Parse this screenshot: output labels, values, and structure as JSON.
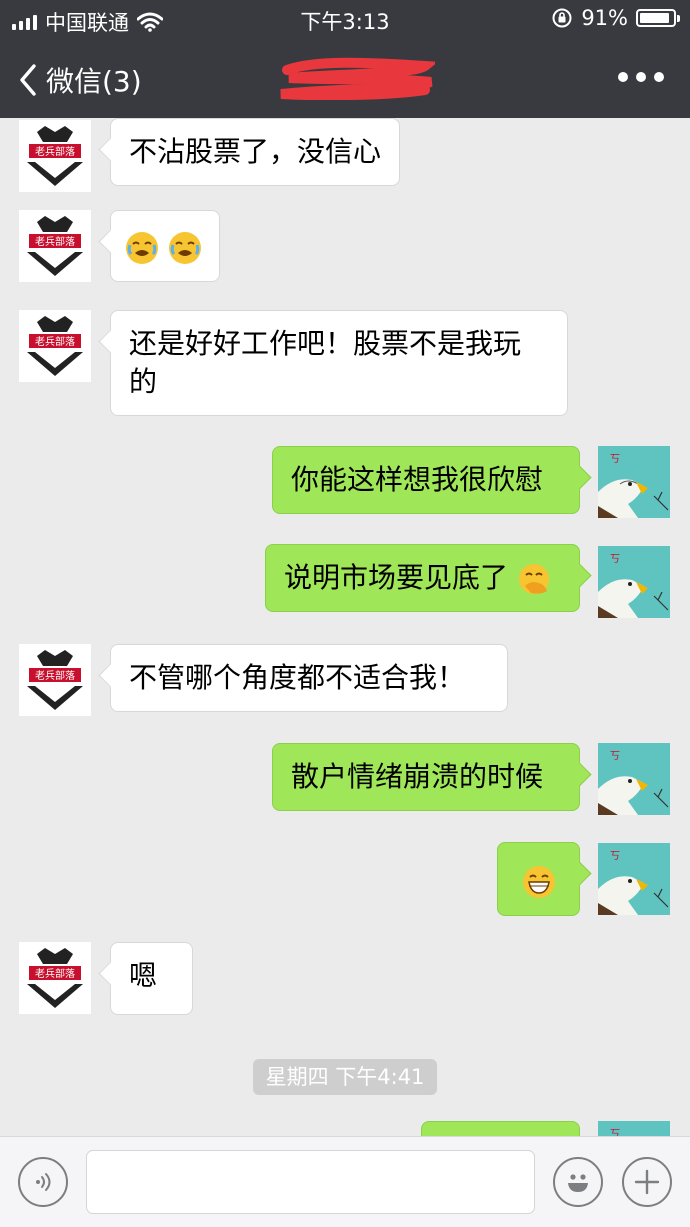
{
  "status_bar": {
    "carrier": "中国联通",
    "time": "下午3:13",
    "battery_percent": "91%",
    "battery_level": 0.91
  },
  "nav": {
    "back_label": "微信(3)",
    "title": ""
  },
  "messages": [
    {
      "side": "left",
      "text": "不沾股票了，没信心"
    },
    {
      "side": "left",
      "text": "",
      "emojis": [
        "crying-face-icon",
        "crying-face-icon"
      ]
    },
    {
      "side": "left",
      "line1": "还是好好工作吧！股票不是我玩",
      "line2": "的"
    },
    {
      "side": "right",
      "text": "你能这样想我很欣慰"
    },
    {
      "side": "right",
      "text": "说明市场要见底了",
      "emojis": [
        "hand-over-mouth-face-icon"
      ]
    },
    {
      "side": "left",
      "text": "不管哪个角度都不适合我！"
    },
    {
      "side": "right",
      "text": "散户情绪崩溃的时候"
    },
    {
      "side": "right",
      "text": "",
      "emojis": [
        "grinning-face-icon"
      ]
    },
    {
      "side": "left",
      "text": "嗯"
    }
  ],
  "timestamp": "星期四 下午4:41",
  "avatars": {
    "left_logo_text": "老兵部落"
  },
  "colors": {
    "header_bg": "#393a3f",
    "chat_bg": "#ebebeb",
    "sent_bubble": "#9fe658",
    "received_bubble": "#ffffff"
  }
}
